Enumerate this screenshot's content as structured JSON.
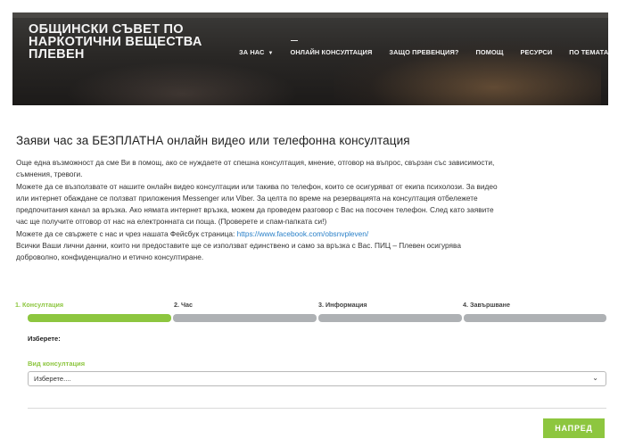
{
  "header": {
    "brand_line1": "ОБЩИНСКИ СЪВЕТ ПО",
    "brand_line2": "НАРКОТИЧНИ ВЕЩЕСТВА",
    "brand_line3": "ПЛЕВЕН",
    "nav": [
      {
        "label": "ЗА НАС"
      },
      {
        "label": "ОНЛАЙН КОНСУЛТАЦИЯ"
      },
      {
        "label": "ЗАЩО ПРЕВЕНЦИЯ?"
      },
      {
        "label": "ПОМОЩ"
      },
      {
        "label": "РЕСУРСИ"
      },
      {
        "label": "ПО ТЕМАТА"
      }
    ]
  },
  "main": {
    "title": "Заяви час за БЕЗПЛАТНА онлайн видео или телефонна консултация",
    "p1": "Още една възможност да сме Ви в помощ, ако се нуждаете от спешна консултация, мнение, отговор на въпрос, свързан със зависимости,",
    "p1b": "съмнения, тревоги.",
    "p2": "Можете да се възползвате от нашите онлайн видео консултации или такива по телефон, които се осигуряват от екипа психолози. За видео",
    "p2b": "или интернет обаждане се ползват приложения Messenger или Viber. За целта по време на резервацията на консултация отбележете",
    "p2c": "предпочитания канал за връзка. Ако нямата интернет връзка, можем да проведем разговор с Вас на посочен телефон. След като заявите",
    "p2d": "час ще получите отговор от нас на електронната си поща. (Проверете и спам-папката си!)",
    "p3": "Можете да се свържете с нас и чрез нашата Фейсбук страница: ",
    "p3_link": "https://www.facebook.com/obsnvpleven/",
    "p4": "Всички Ваши лични данни, които ни предоставите ще се използват единствено и само за връзка с Вас. ПИЦ – Плевен осигурява",
    "p4b": "доброволно, конфиденциално и етично консултиране."
  },
  "steps": [
    {
      "label": "1. Консултация",
      "active": true
    },
    {
      "label": "2. Час",
      "active": false
    },
    {
      "label": "3. Информация",
      "active": false
    },
    {
      "label": "4. Завършване",
      "active": false
    }
  ],
  "form": {
    "choose_label": "Изберете:",
    "type_label": "Вид консултация",
    "select_value": "Изберете...."
  },
  "buttons": {
    "next_label": "НАПРЕД"
  },
  "colors": {
    "accent": "#8dc63f",
    "inactive_step": "#aeb1b4",
    "link": "#2a80c8"
  }
}
